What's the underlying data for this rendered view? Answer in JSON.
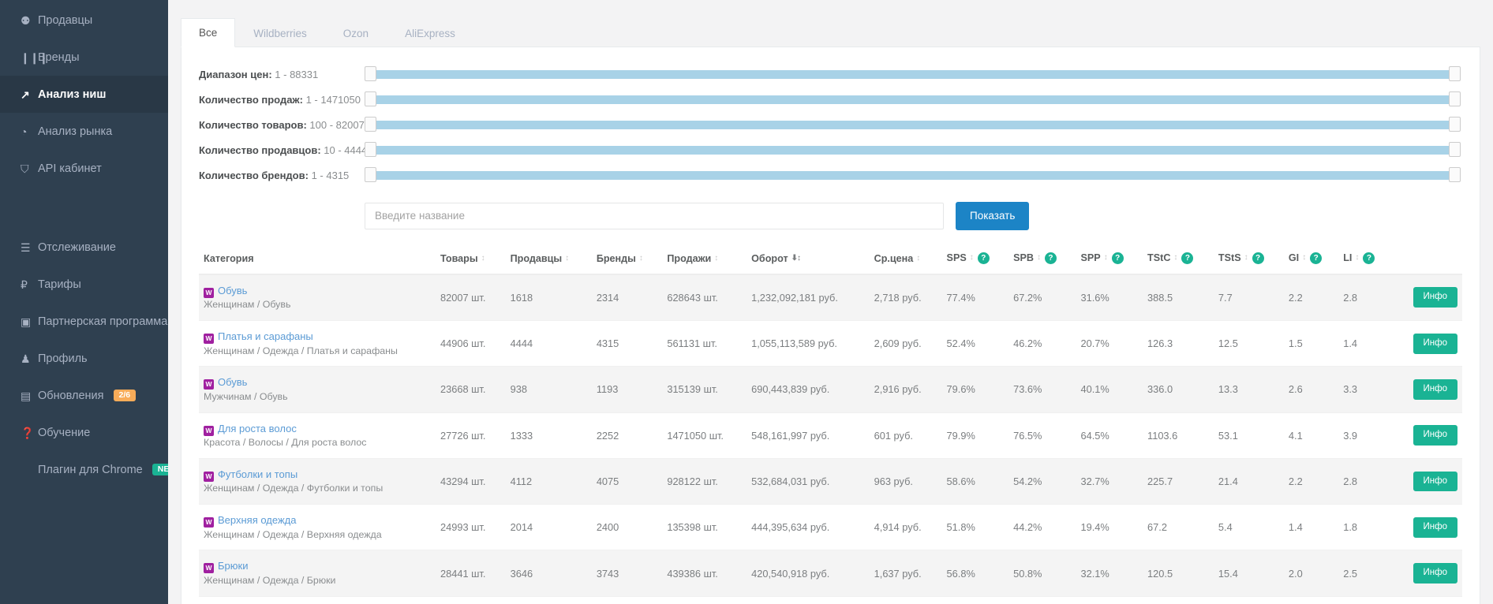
{
  "sidebar": {
    "items": [
      {
        "label": "Продавцы",
        "icon": "users-icon",
        "glyph": "⚉",
        "active": false,
        "badge": null
      },
      {
        "label": "Бренды",
        "icon": "bar-chart-icon",
        "glyph": "❙❙❙",
        "active": false,
        "badge": null
      },
      {
        "label": "Анализ ниш",
        "icon": "line-chart-icon",
        "glyph": "↗",
        "active": true,
        "badge": null
      },
      {
        "label": "Анализ рынка",
        "icon": "pie-chart-icon",
        "glyph": "◔",
        "active": false,
        "badge": null
      },
      {
        "label": "API кабинет",
        "icon": "cart-icon",
        "glyph": "⛉",
        "active": false,
        "badge": null
      },
      {
        "label": "Отслеживание",
        "icon": "list-icon",
        "glyph": "☰",
        "active": false,
        "badge": null
      },
      {
        "label": "Тарифы",
        "icon": "ruble-icon",
        "glyph": "₽",
        "active": false,
        "badge": null
      },
      {
        "label": "Партнерская программа",
        "icon": "money-icon",
        "glyph": "▣",
        "active": false,
        "badge": null
      },
      {
        "label": "Профиль",
        "icon": "user-icon",
        "glyph": "♟",
        "active": false,
        "badge": null
      },
      {
        "label": "Обновления",
        "icon": "news-icon",
        "glyph": "▤",
        "active": false,
        "badge": "2/6",
        "badge_color": "orange"
      },
      {
        "label": "Обучение",
        "icon": "question-circle-icon",
        "glyph": "❓",
        "active": false,
        "badge": null
      },
      {
        "label": "Плагин для Chrome",
        "icon": "chrome-plugin-icon",
        "glyph": "",
        "active": false,
        "badge": "NEW",
        "badge_color": "teal"
      }
    ]
  },
  "tabs": [
    {
      "label": "Все",
      "active": true
    },
    {
      "label": "Wildberries",
      "active": false
    },
    {
      "label": "Ozon",
      "active": false
    },
    {
      "label": "AliExpress",
      "active": false
    }
  ],
  "filters": [
    {
      "label": "Диапазон цен:",
      "value": "1 - 88331"
    },
    {
      "label": "Количество продаж:",
      "value": "1 - 1471050"
    },
    {
      "label": "Количество товаров:",
      "value": "100 - 82007"
    },
    {
      "label": "Количество продавцов:",
      "value": "10 - 4444"
    },
    {
      "label": "Количество брендов:",
      "value": "1 - 4315"
    }
  ],
  "search": {
    "placeholder": "Введите название",
    "value": "",
    "button_label": "Показать"
  },
  "table": {
    "columns": [
      {
        "key": "category",
        "label": "Категория",
        "sortable": false,
        "help": false
      },
      {
        "key": "goods",
        "label": "Товары",
        "sortable": true,
        "help": false
      },
      {
        "key": "sellers",
        "label": "Продавцы",
        "sortable": true,
        "help": false
      },
      {
        "key": "brands",
        "label": "Бренды",
        "sortable": true,
        "help": false
      },
      {
        "key": "sales",
        "label": "Продажи",
        "sortable": true,
        "help": false
      },
      {
        "key": "turnover",
        "label": "Оборот",
        "sortable": true,
        "sorted": "desc",
        "help": false
      },
      {
        "key": "avg_price",
        "label": "Ср.цена",
        "sortable": true,
        "help": false
      },
      {
        "key": "sps",
        "label": "SPS",
        "sortable": true,
        "help": true
      },
      {
        "key": "spb",
        "label": "SPB",
        "sortable": true,
        "help": true
      },
      {
        "key": "spp",
        "label": "SPP",
        "sortable": true,
        "help": true
      },
      {
        "key": "tstc",
        "label": "TStC",
        "sortable": true,
        "help": true
      },
      {
        "key": "tsts",
        "label": "TStS",
        "sortable": true,
        "help": true
      },
      {
        "key": "gi",
        "label": "GI",
        "sortable": true,
        "help": true
      },
      {
        "key": "li",
        "label": "LI",
        "sortable": true,
        "help": true
      },
      {
        "key": "action",
        "label": "",
        "sortable": false,
        "help": false
      }
    ],
    "info_button_label": "Инфо",
    "marketplace_badge": "W",
    "rows": [
      {
        "name": "Обувь",
        "path": "Женщинам / Обувь",
        "goods": "82007 шт.",
        "sellers": "1618",
        "brands": "2314",
        "sales": "628643 шт.",
        "turnover": "1,232,092,181 руб.",
        "avg_price": "2,718 руб.",
        "sps": "77.4%",
        "spb": "67.2%",
        "spp": "31.6%",
        "tstc": "388.5",
        "tsts": "7.7",
        "gi": "2.2",
        "li": "2.8"
      },
      {
        "name": "Платья и сарафаны",
        "path": "Женщинам / Одежда / Платья и сарафаны",
        "goods": "44906 шт.",
        "sellers": "4444",
        "brands": "4315",
        "sales": "561131 шт.",
        "turnover": "1,055,113,589 руб.",
        "avg_price": "2,609 руб.",
        "sps": "52.4%",
        "spb": "46.2%",
        "spp": "20.7%",
        "tstc": "126.3",
        "tsts": "12.5",
        "gi": "1.5",
        "li": "1.4"
      },
      {
        "name": "Обувь",
        "path": "Мужчинам / Обувь",
        "goods": "23668 шт.",
        "sellers": "938",
        "brands": "1193",
        "sales": "315139 шт.",
        "turnover": "690,443,839 руб.",
        "avg_price": "2,916 руб.",
        "sps": "79.6%",
        "spb": "73.6%",
        "spp": "40.1%",
        "tstc": "336.0",
        "tsts": "13.3",
        "gi": "2.6",
        "li": "3.3"
      },
      {
        "name": "Для роста волос",
        "path": "Красота / Волосы / Для роста волос",
        "goods": "27726 шт.",
        "sellers": "1333",
        "brands": "2252",
        "sales": "1471050 шт.",
        "turnover": "548,161,997 руб.",
        "avg_price": "601 руб.",
        "sps": "79.9%",
        "spb": "76.5%",
        "spp": "64.5%",
        "tstc": "1103.6",
        "tsts": "53.1",
        "gi": "4.1",
        "li": "3.9"
      },
      {
        "name": "Футболки и топы",
        "path": "Женщинам / Одежда / Футболки и топы",
        "goods": "43294 шт.",
        "sellers": "4112",
        "brands": "4075",
        "sales": "928122 шт.",
        "turnover": "532,684,031 руб.",
        "avg_price": "963 руб.",
        "sps": "58.6%",
        "spb": "54.2%",
        "spp": "32.7%",
        "tstc": "225.7",
        "tsts": "21.4",
        "gi": "2.2",
        "li": "2.8"
      },
      {
        "name": "Верхняя одежда",
        "path": "Женщинам / Одежда / Верхняя одежда",
        "goods": "24993 шт.",
        "sellers": "2014",
        "brands": "2400",
        "sales": "135398 шт.",
        "turnover": "444,395,634 руб.",
        "avg_price": "4,914 руб.",
        "sps": "51.8%",
        "spb": "44.2%",
        "spp": "19.4%",
        "tstc": "67.2",
        "tsts": "5.4",
        "gi": "1.4",
        "li": "1.8"
      },
      {
        "name": "Брюки",
        "path": "Женщинам / Одежда / Брюки",
        "goods": "28441 шт.",
        "sellers": "3646",
        "brands": "3743",
        "sales": "439386 шт.",
        "turnover": "420,540,918 руб.",
        "avg_price": "1,637 руб.",
        "sps": "56.8%",
        "spb": "50.8%",
        "spp": "32.1%",
        "tstc": "120.5",
        "tsts": "15.4",
        "gi": "2.0",
        "li": "2.5"
      }
    ]
  },
  "colors": {
    "sidebar_bg": "#2f4050",
    "sidebar_active_bg": "#293846",
    "primary_button": "#1c84c6",
    "success_green": "#1ab394",
    "badge_orange": "#f8ac59",
    "slider_track": "#a8d2e7",
    "link_blue": "#5b9bd5",
    "wb_purple": "#a020a0"
  }
}
